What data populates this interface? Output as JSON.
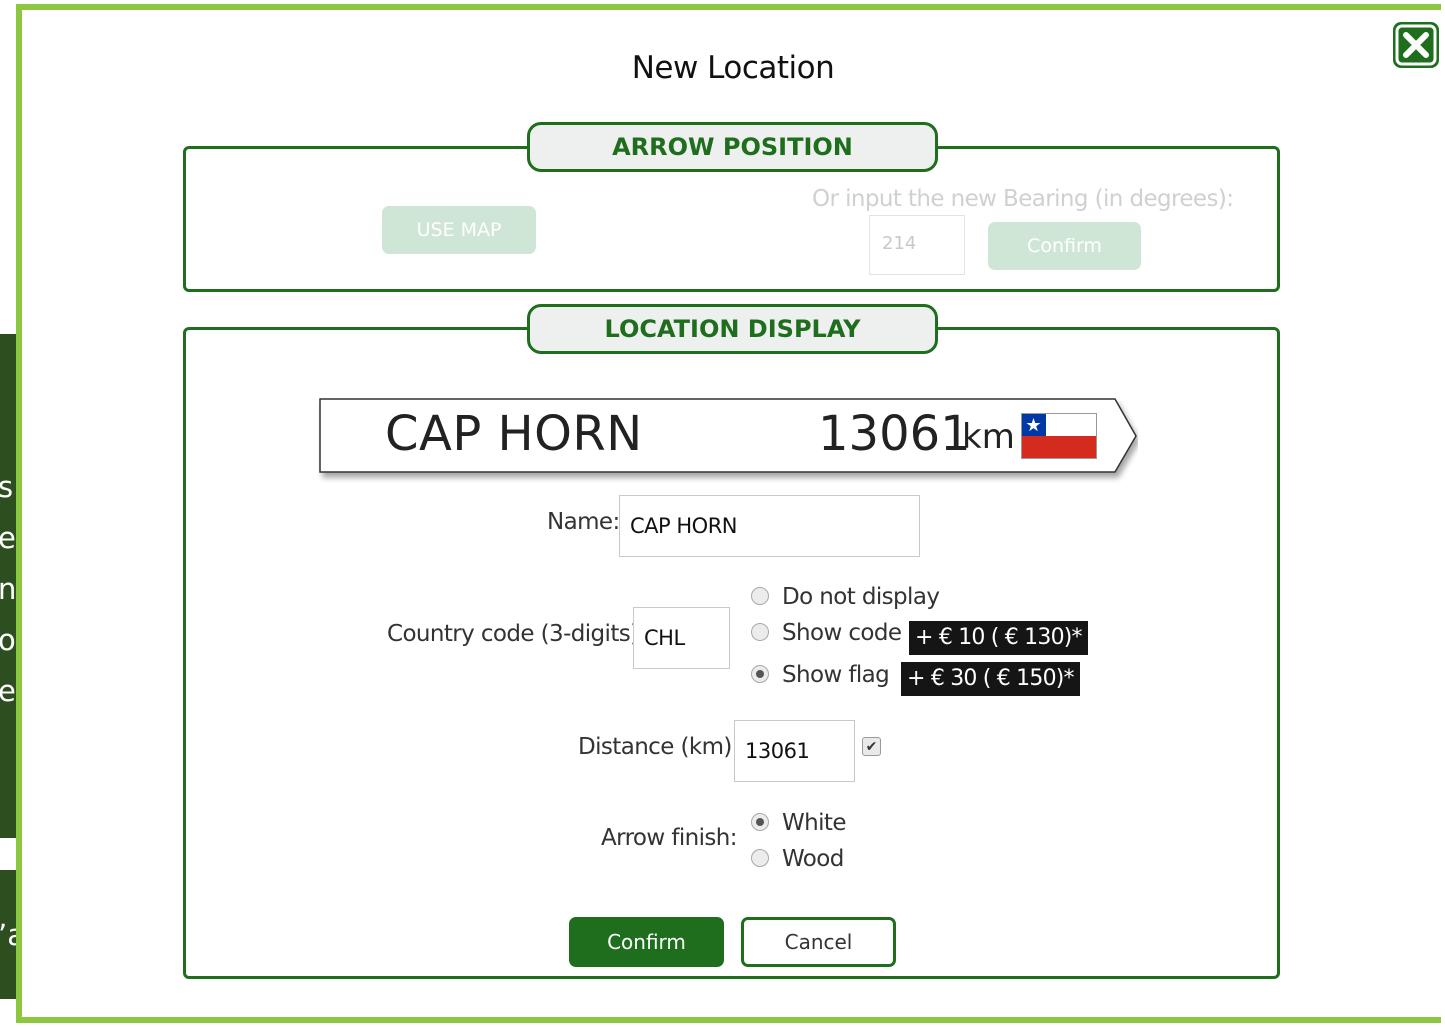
{
  "background": {
    "panel1_lines": [
      "s",
      "e la",
      "n avec",
      "on",
      "e"
    ],
    "panel2_text": "’ajout"
  },
  "modal": {
    "title": "New Location",
    "close_icon": "close-x-icon"
  },
  "arrow_position": {
    "tab_label": "ARROW POSITION",
    "use_map_label": "USE MAP",
    "bearing_label": "Or input the new Bearing (in degrees):",
    "bearing_value": "214",
    "confirm_label": "Confirm"
  },
  "location_display": {
    "tab_label": "LOCATION DISPLAY",
    "preview": {
      "name": "CAP HORN",
      "distance": "13061",
      "unit": "km",
      "flag_icon": "chile-flag-icon"
    },
    "name_label": "Name:",
    "name_value": "CAP HORN",
    "country_label": "Country code (3-digits):",
    "country_value": "CHL",
    "country_options": [
      {
        "label": "Do not display",
        "checked": false
      },
      {
        "label": "Show code",
        "checked": false,
        "price": "+ € 10 ( € 130)*"
      },
      {
        "label": "Show flag",
        "checked": true,
        "price": "+ € 30 ( € 150)*"
      }
    ],
    "distance_label": "Distance (km):",
    "distance_value": "13061",
    "distance_checked": true,
    "finish_label": "Arrow finish:",
    "finish_options": [
      {
        "label": "White",
        "checked": true
      },
      {
        "label": "Wood",
        "checked": false
      }
    ],
    "confirm_label": "Confirm",
    "cancel_label": "Cancel"
  },
  "colors": {
    "accent_green": "#1e6e1e",
    "frame_green": "#8dc63f",
    "panel_green": "#2d4e1e",
    "flag_red": "#d52b1e",
    "flag_blue": "#0039a6"
  }
}
